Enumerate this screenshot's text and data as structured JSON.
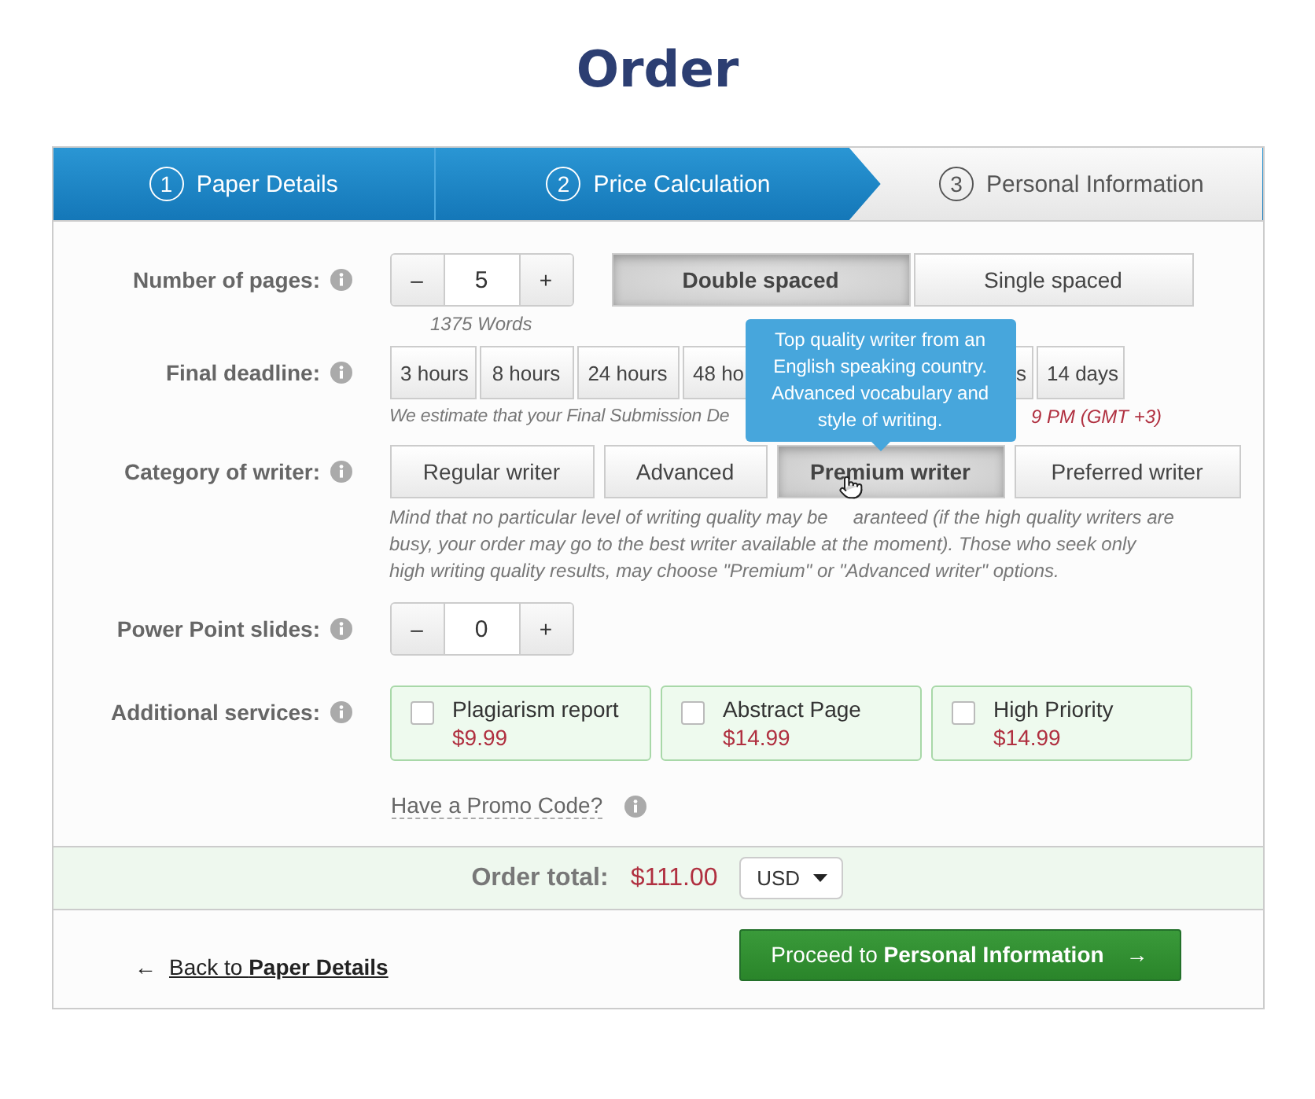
{
  "title": "Order",
  "steps": [
    {
      "number": "1",
      "label": "Paper Details",
      "active": true
    },
    {
      "number": "2",
      "label": "Price Calculation",
      "active": true
    },
    {
      "number": "3",
      "label": "Personal Information",
      "active": false
    }
  ],
  "pages": {
    "label": "Number of pages:",
    "minus": "–",
    "value": "5",
    "plus": "+",
    "words": "1375 Words",
    "spacing": [
      {
        "label": "Double spaced",
        "selected": true
      },
      {
        "label": "Single spaced",
        "selected": false
      }
    ]
  },
  "deadline": {
    "label": "Final deadline:",
    "options": [
      {
        "label": "3 hours",
        "kind": "full"
      },
      {
        "label": "8 hours",
        "kind": "full"
      },
      {
        "label": "24 hours",
        "kind": "full"
      },
      {
        "label": "48 ho",
        "kind": "cut-right"
      },
      {
        "label": "s",
        "kind": "cut-left"
      },
      {
        "label": "14 days",
        "kind": "full"
      }
    ],
    "estimate": "We estimate that your Final Submission De",
    "estimate_date": "9 PM (GMT +3)"
  },
  "tooltip": "Top quality writer from an English speaking country. Advanced vocabulary and style of writing.",
  "writer": {
    "label": "Category of writer:",
    "options": [
      {
        "label": "Regular writer",
        "selected": false
      },
      {
        "label": "Advanced",
        "selected": false
      },
      {
        "label": "Premium writer",
        "selected": true
      },
      {
        "label": "Preferred writer",
        "selected": false
      }
    ],
    "note_start": "Mind that no particular level of writing quality may be",
    "note_end": "aranteed (if the high quality writers are busy, your order may go to the best writer available at the moment). Those who seek only high writing quality results, may choose \"Premium\" or \"Advanced writer\" options."
  },
  "slides": {
    "label": "Power Point slides:",
    "minus": "–",
    "value": "0",
    "plus": "+"
  },
  "services": {
    "label": "Additional services:",
    "items": [
      {
        "name": "Plagiarism report",
        "price": "$9.99",
        "checked": false
      },
      {
        "name": "Abstract Page",
        "price": "$14.99",
        "checked": false
      },
      {
        "name": "High Priority",
        "price": "$14.99",
        "checked": false
      }
    ]
  },
  "promo": "Have a Promo Code?",
  "total": {
    "label": "Order total:",
    "amount": "$111.00",
    "currency": "USD"
  },
  "back": {
    "arrow": "←",
    "text": "Back to **Paper Details**"
  },
  "proceed": {
    "text": "Proceed to **Personal Information**",
    "arrow": "→"
  }
}
